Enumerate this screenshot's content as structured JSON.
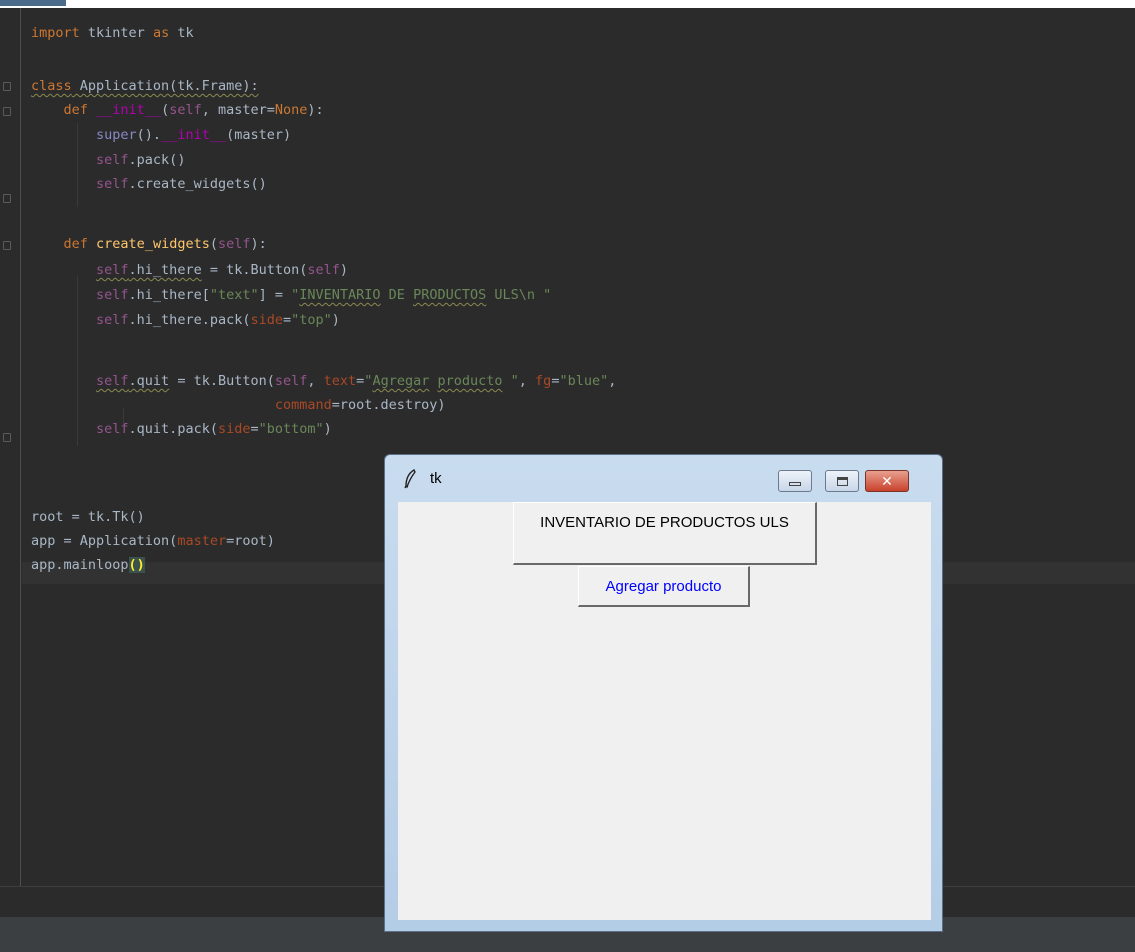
{
  "editor": {
    "code_line_1": "import tkinter as tk",
    "code_line_3": "class Application(tk.Frame):",
    "code_line_4": "    def __init__(self, master=None):",
    "code_line_5": "        super().__init__(master)",
    "code_line_6": "        self.pack()",
    "code_line_7": "        self.create_widgets()",
    "code_line_9": "    def create_widgets(self):",
    "code_line_10": "        self.hi_there = tk.Button(self)",
    "code_line_11": "        self.hi_there[\"text\"] = \"INVENTARIO DE PRODUCTOS ULS\\n \"",
    "code_line_12": "        self.hi_there.pack(side=\"top\")",
    "code_line_14": "        self.quit = tk.Button(self, text=\"Agregar producto \", fg=\"blue\",",
    "code_line_15": "                              command=root.destroy)",
    "code_line_16": "        self.quit.pack(side=\"bottom\")",
    "code_line_19": "root = tk.Tk()",
    "code_line_20": "app = Application(master=root)",
    "code_line_21": "app.mainloop()"
  },
  "tk_window": {
    "title": "tk",
    "icon": "feather-icon",
    "button_inventario_label": "INVENTARIO DE PRODUCTOS ULS",
    "button_agregar_label": "Agregar producto",
    "button_agregar_color": "#0000ff"
  }
}
